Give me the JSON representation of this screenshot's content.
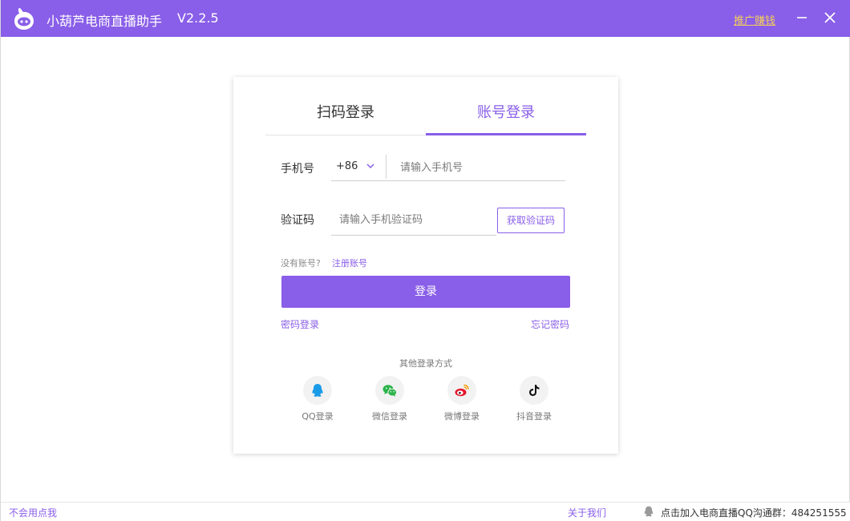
{
  "titlebar": {
    "app_name": "小葫芦电商直播助手",
    "version": "V2.2.5",
    "promo_link": "推广赚钱"
  },
  "tabs": [
    {
      "label": "扫码登录",
      "active": false
    },
    {
      "label": "账号登录",
      "active": true
    }
  ],
  "form": {
    "phone_label": "手机号",
    "country_code": "+86",
    "phone_placeholder": "请输入手机号",
    "code_label": "验证码",
    "code_placeholder": "请输入手机验证码",
    "get_code_button": "获取验证码",
    "no_account_text": "没有账号?",
    "register_link": "注册账号",
    "login_button": "登录",
    "password_login_link": "密码登录",
    "forgot_password_link": "忘记密码"
  },
  "other_login": {
    "title": "其他登录方式",
    "options": [
      {
        "label": "QQ登录",
        "icon": "qq-icon"
      },
      {
        "label": "微信登录",
        "icon": "wechat-icon"
      },
      {
        "label": "微博登录",
        "icon": "weibo-icon"
      },
      {
        "label": "抖音登录",
        "icon": "douyin-icon"
      }
    ]
  },
  "statusbar": {
    "feedback_link": "不会用点我",
    "about_link": "关于我们",
    "qq_group_text": "点击加入电商直播QQ沟通群：484251555"
  },
  "colors": {
    "accent": "#895ee8",
    "promo": "#f5d05a"
  }
}
